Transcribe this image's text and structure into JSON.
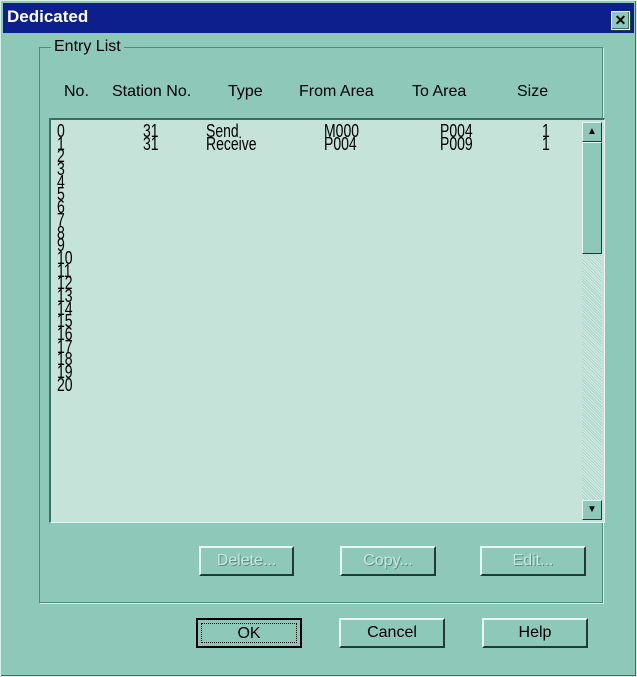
{
  "dialog": {
    "title": "Dedicated",
    "close_glyph": "✕"
  },
  "entry_list": {
    "group_label": "Entry List",
    "columns": {
      "no": "No.",
      "station_no": "Station No.",
      "type": "Type",
      "from_area": "From Area",
      "to_area": "To Area",
      "size": "Size"
    },
    "rows": [
      {
        "no": "0",
        "station": "31",
        "type": "Send",
        "from": "M000",
        "to": "P004",
        "size": "1"
      },
      {
        "no": "1",
        "station": "31",
        "type": "Receive",
        "from": "P004",
        "to": "P009",
        "size": "1"
      },
      {
        "no": "2",
        "station": "",
        "type": "",
        "from": "",
        "to": "",
        "size": ""
      },
      {
        "no": "3",
        "station": "",
        "type": "",
        "from": "",
        "to": "",
        "size": ""
      },
      {
        "no": "4",
        "station": "",
        "type": "",
        "from": "",
        "to": "",
        "size": ""
      },
      {
        "no": "5",
        "station": "",
        "type": "",
        "from": "",
        "to": "",
        "size": ""
      },
      {
        "no": "6",
        "station": "",
        "type": "",
        "from": "",
        "to": "",
        "size": ""
      },
      {
        "no": "7",
        "station": "",
        "type": "",
        "from": "",
        "to": "",
        "size": ""
      },
      {
        "no": "8",
        "station": "",
        "type": "",
        "from": "",
        "to": "",
        "size": ""
      },
      {
        "no": "9",
        "station": "",
        "type": "",
        "from": "",
        "to": "",
        "size": ""
      },
      {
        "no": "10",
        "station": "",
        "type": "",
        "from": "",
        "to": "",
        "size": ""
      },
      {
        "no": "11",
        "station": "",
        "type": "",
        "from": "",
        "to": "",
        "size": ""
      },
      {
        "no": "12",
        "station": "",
        "type": "",
        "from": "",
        "to": "",
        "size": ""
      },
      {
        "no": "13",
        "station": "",
        "type": "",
        "from": "",
        "to": "",
        "size": ""
      },
      {
        "no": "14",
        "station": "",
        "type": "",
        "from": "",
        "to": "",
        "size": ""
      },
      {
        "no": "15",
        "station": "",
        "type": "",
        "from": "",
        "to": "",
        "size": ""
      },
      {
        "no": "16",
        "station": "",
        "type": "",
        "from": "",
        "to": "",
        "size": ""
      },
      {
        "no": "17",
        "station": "",
        "type": "",
        "from": "",
        "to": "",
        "size": ""
      },
      {
        "no": "18",
        "station": "",
        "type": "",
        "from": "",
        "to": "",
        "size": ""
      },
      {
        "no": "19",
        "station": "",
        "type": "",
        "from": "",
        "to": "",
        "size": ""
      },
      {
        "no": "20",
        "station": "",
        "type": "",
        "from": "",
        "to": "",
        "size": ""
      }
    ],
    "scrollbar": {
      "up_glyph": "▲",
      "down_glyph": "▼"
    }
  },
  "list_actions": {
    "delete_label": "Delete...",
    "copy_label": "Copy...",
    "edit_label": "Edit..."
  },
  "dialog_buttons": {
    "ok_label": "OK",
    "cancel_label": "Cancel",
    "help_label": "Help"
  }
}
